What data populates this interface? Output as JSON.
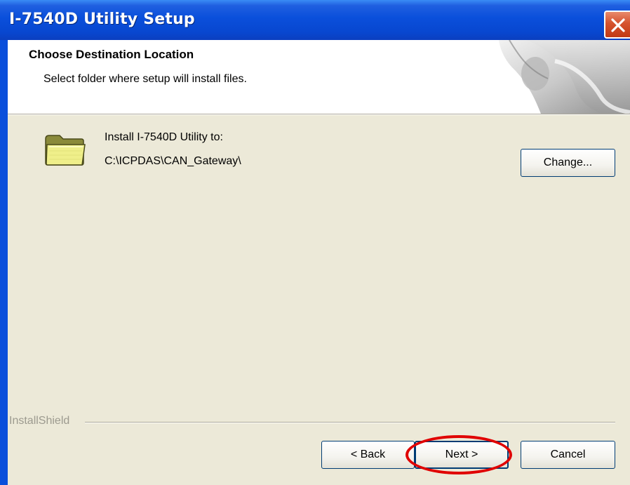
{
  "window": {
    "title": "I-7540D Utility Setup",
    "close_label": "Close"
  },
  "header": {
    "title": "Choose Destination Location",
    "subtitle": "Select folder where setup will install files."
  },
  "destination": {
    "label": "Install I-7540D Utility to:",
    "path": "C:\\ICPDAS\\CAN_Gateway\\",
    "change_label": "Change..."
  },
  "footer": {
    "brand": "InstallShield",
    "back_label": "< Back",
    "next_label": "Next >",
    "cancel_label": "Cancel"
  },
  "icons": {
    "folder": "folder-icon",
    "close": "close-icon",
    "header_art": "setup-graphic-icon"
  },
  "colors": {
    "titlebar": "#0a4fdb",
    "dialog_bg": "#ece9d8",
    "header_bg": "#ffffff",
    "close_button": "#d5532e",
    "highlight": "#e00000",
    "button_border": "#003c74"
  }
}
